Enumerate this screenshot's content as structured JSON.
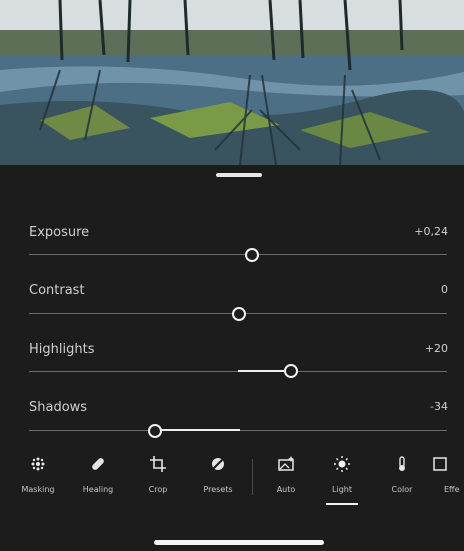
{
  "sliders": [
    {
      "name": "Exposure",
      "value": "+0,24",
      "position": 0.53
    },
    {
      "name": "Contrast",
      "value": "0",
      "position": 0.5
    },
    {
      "name": "Highlights",
      "value": "+20",
      "position": 0.6
    },
    {
      "name": "Shadows",
      "value": "-34",
      "position": 0.33
    }
  ],
  "tools": [
    {
      "label": "Masking",
      "icon": "masking-icon"
    },
    {
      "label": "Healing",
      "icon": "healing-icon"
    },
    {
      "label": "Crop",
      "icon": "crop-icon"
    },
    {
      "label": "Presets",
      "icon": "presets-icon"
    },
    {
      "label": "Auto",
      "icon": "auto-icon"
    },
    {
      "label": "Light",
      "icon": "light-icon",
      "active": true
    },
    {
      "label": "Color",
      "icon": "color-icon"
    },
    {
      "label": "Effe",
      "icon": "effects-icon"
    }
  ]
}
